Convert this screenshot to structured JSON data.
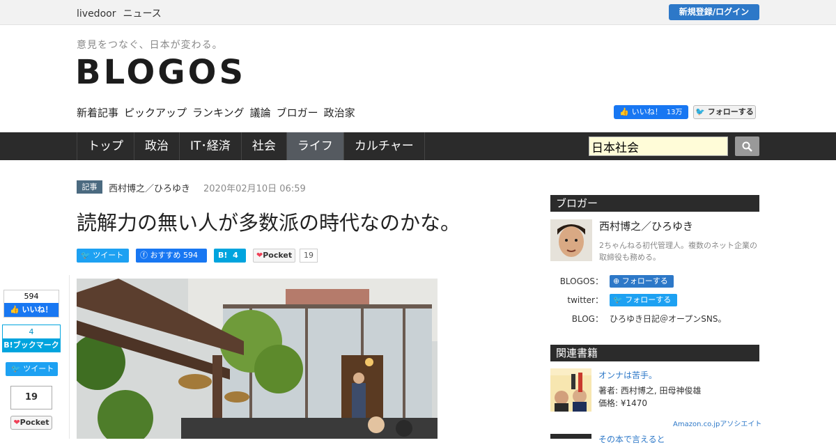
{
  "topbar": {
    "brand": "livedoor",
    "section": "ニュース",
    "login_label": "新規登録/ログイン"
  },
  "header": {
    "tagline": "意見をつなぐ、日本が変わる。",
    "logo": "BLOGOS",
    "subnav": [
      "新着記事",
      "ピックアップ",
      "ランキング",
      "議論",
      "ブロガー",
      "政治家"
    ],
    "fb_like_label": "いいね！",
    "fb_like_count": "13万",
    "twitter_follow_label": "フォローする"
  },
  "mainnav": {
    "items": [
      "トップ",
      "政治",
      "IT･経済",
      "社会",
      "ライフ",
      "カルチャー"
    ],
    "active_index": 4,
    "search_value": "日本社会"
  },
  "article": {
    "badge": "記事",
    "author": "西村博之／ひろゆき",
    "date": "2020年02月10日 06:59",
    "title": "読解力の無い人が多数派の時代なのかな。",
    "share": {
      "tweet_label": "ツイート",
      "fb_label": "おすすめ",
      "fb_count": "594",
      "hatena_label": "B!",
      "hatena_count": "4",
      "pocket_label": "Pocket",
      "pocket_count": "19"
    }
  },
  "side_share": {
    "fb_count": "594",
    "fb_label": "いいね！",
    "hatena_count": "4",
    "hatena_label": "B!ブックマーク",
    "tweet_label": "ツイート",
    "pocket_count": "19",
    "pocket_label": "Pocket"
  },
  "sidebar": {
    "blogger_heading": "ブロガー",
    "blogger_name": "西村博之／ひろゆき",
    "blogger_desc": "2ちゃんねる初代管理人。複数のネット企業の取締役も務める。",
    "blogos_label": "BLOGOS：",
    "blogos_follow": "フォローする",
    "twitter_label": "twitter：",
    "twitter_follow": "フォローする",
    "blog_label": "BLOG：",
    "blog_value": "ひろゆき日記＠オープンSNS。",
    "books_heading": "関連書籍",
    "book_title": "オンナは苦手。",
    "book_authors": "著者: 西村博之, 田母神俊雄",
    "book_price": "価格: ¥1470",
    "amazon_label": "Amazon.co.jpアソシエイト",
    "book2_title": "その本で言えると"
  }
}
